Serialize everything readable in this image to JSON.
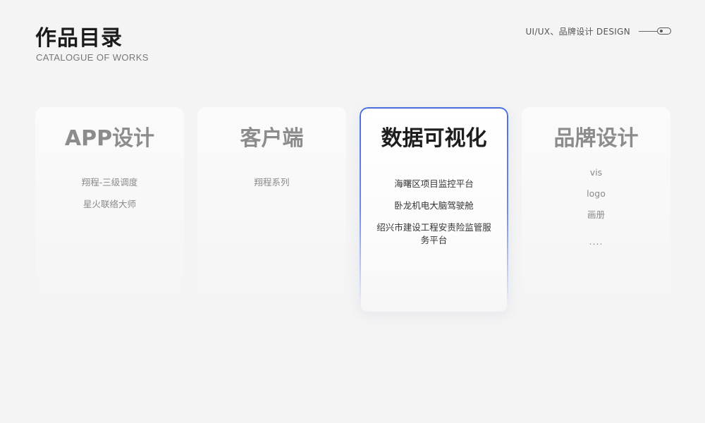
{
  "header": {
    "title": "作品目录",
    "subtitle": "CATALOGUE OF WORKS",
    "tag": "UI/UX、品牌设计  DESIGN"
  },
  "cards": [
    {
      "title": "APP设计",
      "items": [
        "翔程-三级调度",
        "星火联络大师"
      ],
      "active": false
    },
    {
      "title": "客户端",
      "items": [
        "翔程系列"
      ],
      "active": false
    },
    {
      "title": "数据可视化",
      "items": [
        "海曙区项目监控平台",
        "卧龙机电大脑驾驶舱",
        "绍兴市建设工程安责险监管服务平台"
      ],
      "active": true
    },
    {
      "title": "品牌设计",
      "items": [
        "vis",
        "logo",
        "画册",
        "...."
      ],
      "active": false
    }
  ],
  "colors": {
    "background": "#f4f4f4",
    "accent": "#4a6ee0",
    "title_muted": "#8c8c8c",
    "title_active": "#1d1d1d"
  },
  "icons": {
    "toggle": "toggle-icon"
  }
}
